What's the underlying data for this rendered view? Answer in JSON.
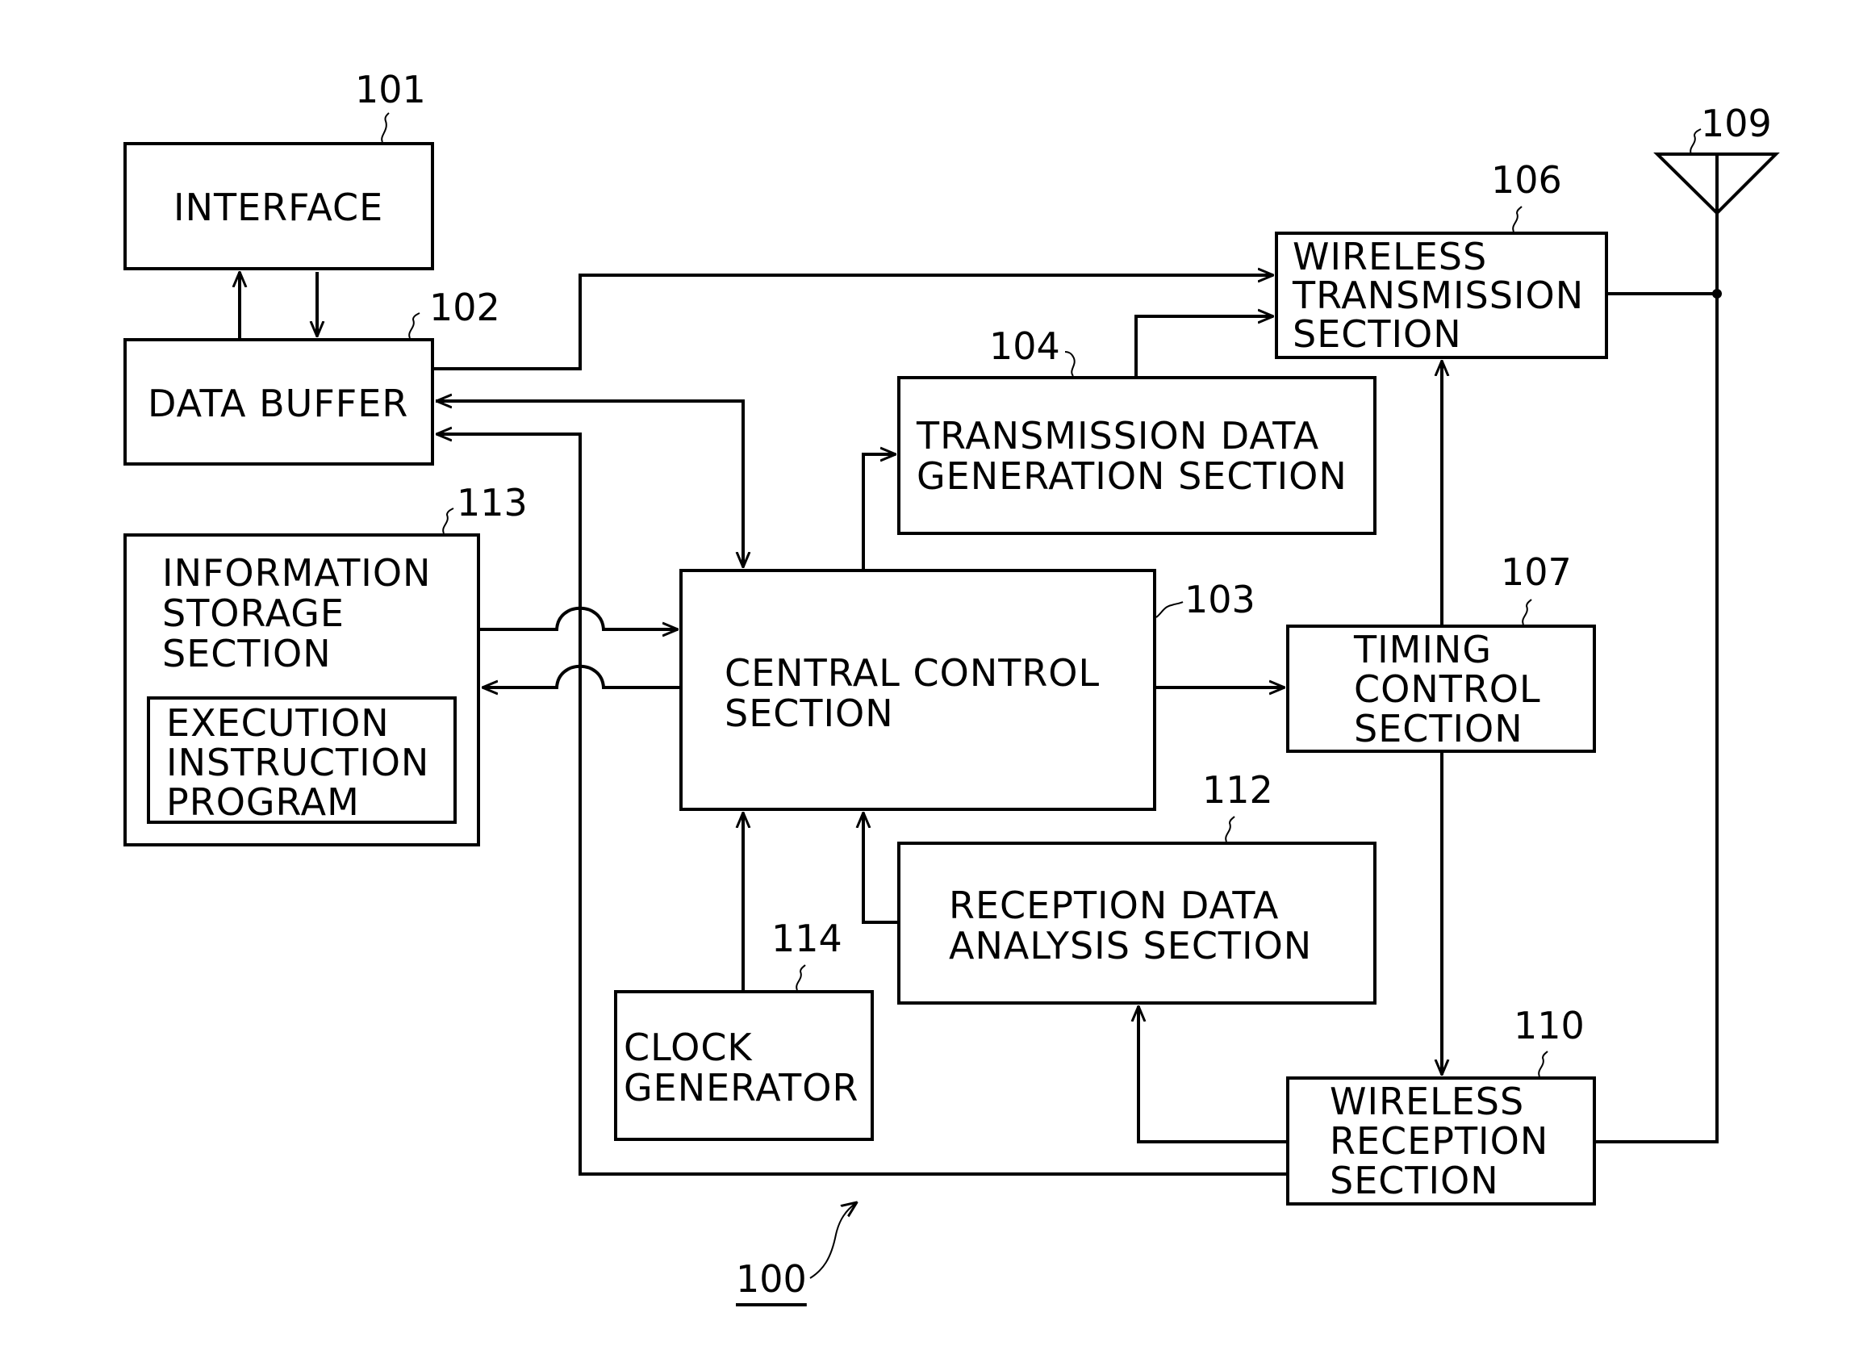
{
  "figure": {
    "reference": "100",
    "blocks": {
      "interface": {
        "ref": "101",
        "label": "INTERFACE"
      },
      "data_buffer": {
        "ref": "102",
        "label": "DATA BUFFER"
      },
      "central_control": {
        "ref": "103",
        "label_lines": [
          "CENTRAL CONTROL",
          "SECTION"
        ]
      },
      "transmission_data_generation": {
        "ref": "104",
        "label_lines": [
          "TRANSMISSION DATA",
          "GENERATION SECTION"
        ]
      },
      "wireless_transmission": {
        "ref": "106",
        "label_lines": [
          "WIRELESS",
          "TRANSMISSION",
          "SECTION"
        ]
      },
      "timing_control": {
        "ref": "107",
        "label_lines": [
          "TIMING",
          "CONTROL",
          "SECTION"
        ]
      },
      "antenna": {
        "ref": "109"
      },
      "wireless_reception": {
        "ref": "110",
        "label_lines": [
          "WIRELESS",
          "RECEPTION",
          "SECTION"
        ]
      },
      "reception_data_analysis": {
        "ref": "112",
        "label_lines": [
          "RECEPTION DATA",
          "ANALYSIS SECTION"
        ]
      },
      "information_storage": {
        "ref": "113",
        "label_lines": [
          "INFORMATION",
          "STORAGE",
          "SECTION"
        ]
      },
      "execution_instruction_program": {
        "label_lines": [
          "EXECUTION",
          "INSTRUCTION",
          "PROGRAM"
        ]
      },
      "clock_generator": {
        "ref": "114",
        "label_lines": [
          "CLOCK",
          "GENERATOR"
        ]
      }
    },
    "connections": [
      {
        "from": "interface",
        "to": "data_buffer"
      },
      {
        "from": "data_buffer",
        "to": "interface"
      },
      {
        "from": "data_buffer",
        "to": "wireless_transmission"
      },
      {
        "from": "data_buffer",
        "to": "central_control"
      },
      {
        "from": "central_control",
        "to": "data_buffer"
      },
      {
        "from": "wireless_reception",
        "to": "data_buffer"
      },
      {
        "from": "information_storage",
        "to": "central_control"
      },
      {
        "from": "central_control",
        "to": "information_storage"
      },
      {
        "from": "central_control",
        "to": "transmission_data_generation"
      },
      {
        "from": "transmission_data_generation",
        "to": "wireless_transmission"
      },
      {
        "from": "central_control",
        "to": "timing_control"
      },
      {
        "from": "timing_control",
        "to": "wireless_transmission"
      },
      {
        "from": "timing_control",
        "to": "wireless_reception"
      },
      {
        "from": "wireless_transmission",
        "to": "antenna"
      },
      {
        "from": "antenna",
        "to": "wireless_reception"
      },
      {
        "from": "wireless_reception",
        "to": "reception_data_analysis"
      },
      {
        "from": "reception_data_analysis",
        "to": "central_control"
      },
      {
        "from": "clock_generator",
        "to": "central_control"
      }
    ]
  }
}
